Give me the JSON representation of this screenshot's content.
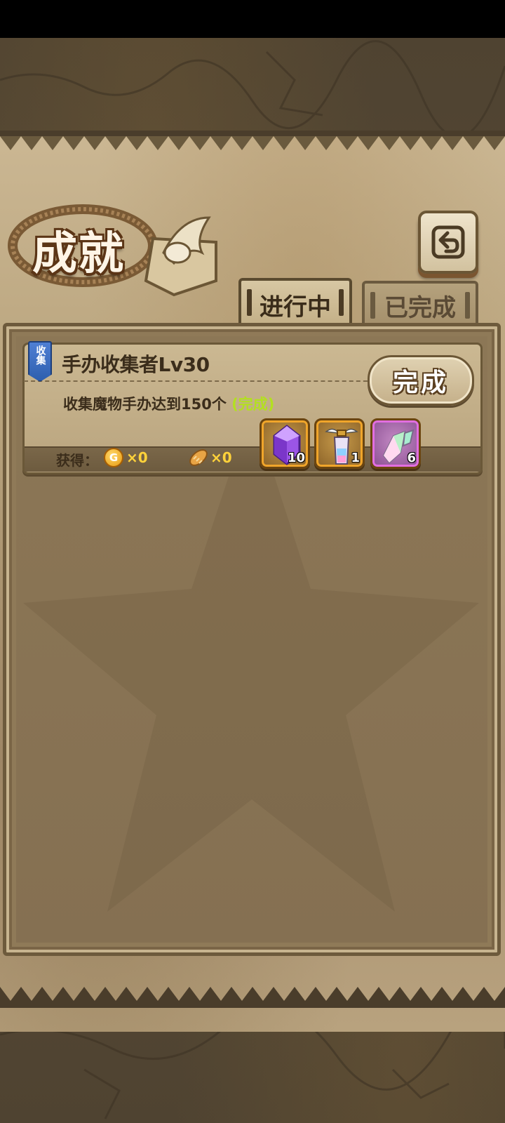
{
  "screen": {
    "title": "成就"
  },
  "tabs": [
    {
      "label": "进行中",
      "active": true
    },
    {
      "label": "已完成",
      "active": false
    }
  ],
  "achievements": [
    {
      "category": "收集",
      "name": "手办收集者Lv30",
      "description": "收集魔物手办达到150个",
      "status_text": "(完成)",
      "button_label": "完成",
      "reward_label": "获得：",
      "coin_symbol": "G",
      "coin_amount": "×0",
      "bread_amount": "×0",
      "items": [
        {
          "icon": "purple-crystal-icon",
          "quantity": "10"
        },
        {
          "icon": "winged-potion-icon",
          "quantity": "1"
        },
        {
          "icon": "rainbow-crystal-icon",
          "quantity": "6"
        }
      ]
    }
  ],
  "colors": {
    "accent_complete": "#b3e020",
    "currency": "#ffd23a",
    "category_badge": "#2e5fae"
  }
}
